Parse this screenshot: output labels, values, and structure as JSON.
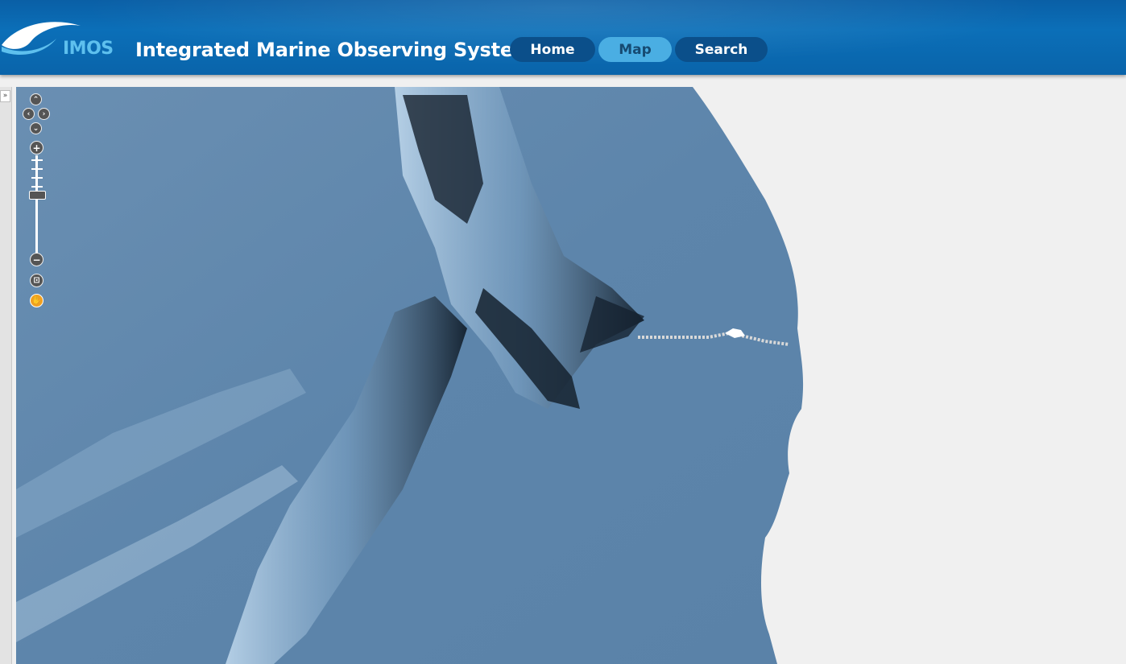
{
  "header": {
    "logo_text": "IMOS",
    "title": "Integrated Marine Observing System",
    "nav": [
      {
        "label": "Home",
        "active": false
      },
      {
        "label": "Map",
        "active": true
      },
      {
        "label": "Search",
        "active": false
      }
    ]
  },
  "sidebar": {
    "expand_label": "»"
  },
  "map": {
    "controls": {
      "pan_up": "⌃",
      "pan_left": "‹",
      "pan_right": "›",
      "pan_down": "⌄",
      "zoom_in": "+",
      "zoom_out": "−",
      "zoom_box": "⊡",
      "pan_tool": "✋"
    },
    "colors": {
      "ocean": "#5e86ab",
      "land": "#f0f0f0",
      "ridge_shadow": "#1b2a3a",
      "ridge_highlight": "#b7d3ea",
      "track": "#d8d8d8"
    }
  }
}
